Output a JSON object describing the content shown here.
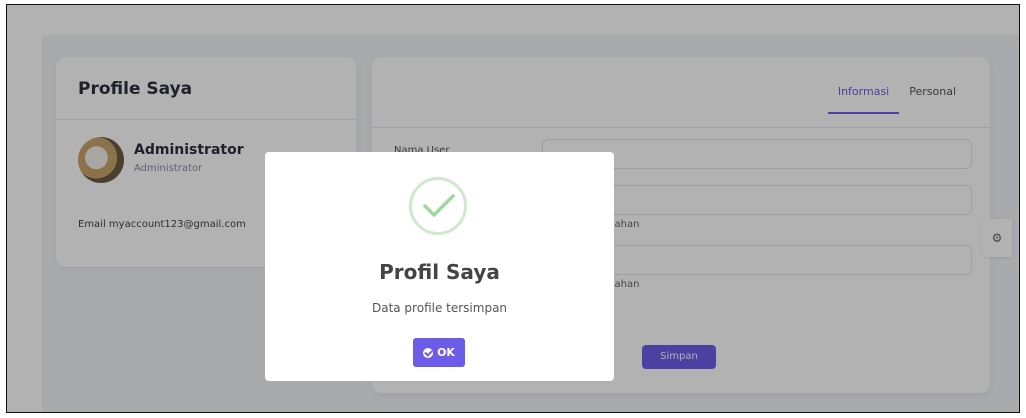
{
  "profile_card": {
    "title": "Profile Saya",
    "user_name": "Administrator",
    "user_role": "Administrator",
    "email": "Email myaccount123@gmail.com",
    "avatar_icon": "user-avatar-icon"
  },
  "form_card": {
    "tabs": [
      {
        "label": "Informasi",
        "active": true
      },
      {
        "label": "Personal",
        "active": false
      }
    ],
    "username_label": "Nama User",
    "password_mask": "...............",
    "hint_no_change_1": "dak ada perubahan",
    "hint_no_change_2": "dak ada perubahan",
    "save_label": "Simpan"
  },
  "side_icon": "gear-icon",
  "modal": {
    "icon": "success-check-icon",
    "title": "Profil Saya",
    "message": "Data profile tersimpan",
    "ok_label": "OK"
  },
  "colors": {
    "accent": "#6d5ce8",
    "success": "#9fd89f"
  }
}
